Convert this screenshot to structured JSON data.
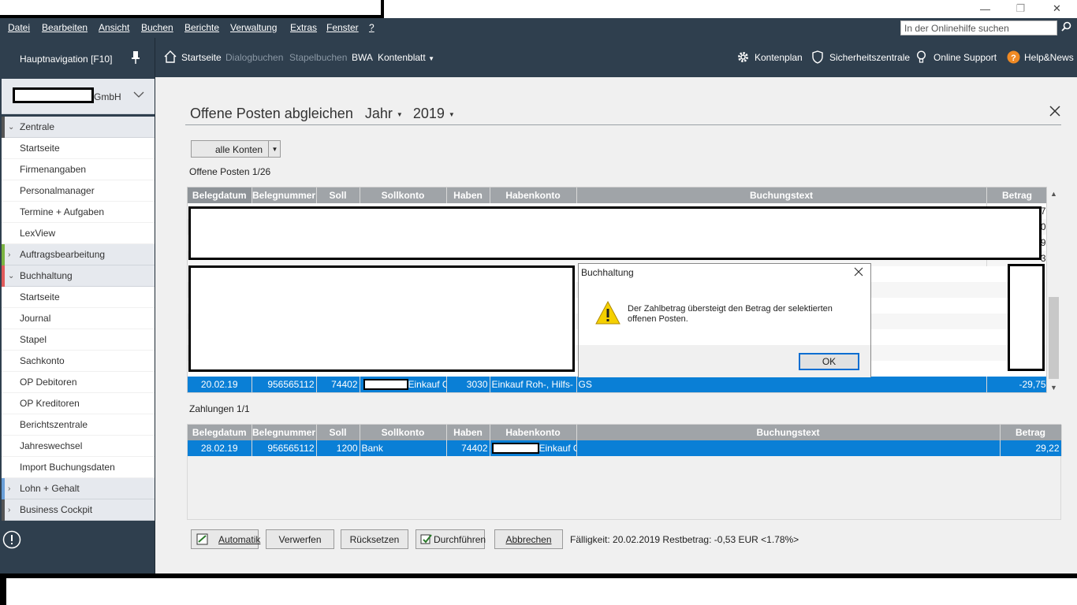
{
  "window": {
    "minimize": "—",
    "restore": "❐",
    "close": "✕"
  },
  "menu": [
    "Datei",
    "Bearbeiten",
    "Ansicht",
    "Buchen",
    "Berichte",
    "Verwaltung",
    "Extras",
    "Fenster",
    "?"
  ],
  "search": {
    "placeholder": "In der Onlinehilfe suchen"
  },
  "sidebar": {
    "header": "Hauptnavigation [F10]",
    "company_suffix": "GmbH",
    "items": [
      {
        "label": "Zentrale",
        "group": true,
        "expanded": true,
        "color": "#555555"
      },
      {
        "label": "Startseite"
      },
      {
        "label": "Firmenangaben"
      },
      {
        "label": "Personalmanager"
      },
      {
        "label": "Termine + Aufgaben"
      },
      {
        "label": "LexView"
      },
      {
        "label": "Auftragsbearbeitung",
        "group": true,
        "expanded": false,
        "color": "#7cb342"
      },
      {
        "label": "Buchhaltung",
        "group": true,
        "expanded": true,
        "color": "#e05a5a"
      },
      {
        "label": "Startseite"
      },
      {
        "label": "Journal"
      },
      {
        "label": "Stapel"
      },
      {
        "label": "Sachkonto"
      },
      {
        "label": "OP Debitoren"
      },
      {
        "label": "OP Kreditoren"
      },
      {
        "label": "Berichtszentrale"
      },
      {
        "label": "Jahreswechsel"
      },
      {
        "label": "Import Buchungsdaten"
      },
      {
        "label": "Lohn + Gehalt",
        "group": true,
        "expanded": false,
        "color": "#6a9fd8"
      },
      {
        "label": "Business Cockpit",
        "group": true,
        "expanded": false,
        "color": "#555555"
      }
    ]
  },
  "toolbar": {
    "startseite": "Startseite",
    "dialogbuchen": "Dialogbuchen",
    "stapelbuchen": "Stapelbuchen",
    "bwa": "BWA",
    "kontenblatt": "Kontenblatt",
    "kontenplan": "Kontenplan",
    "sicherheit": "Sicherheitszentrale",
    "support": "Online Support",
    "help": "Help&News"
  },
  "page": {
    "title": "Offene Posten abgleichen",
    "period_label": "Jahr",
    "year": "2019",
    "account_filter": "alle Konten",
    "op_caption": "Offene Posten 1/26",
    "pay_caption": "Zahlungen 1/1"
  },
  "op_table": {
    "headers": [
      "Belegdatum",
      "Belegnummer",
      "Soll",
      "Sollkonto",
      "Haben",
      "Habenkonto",
      "Buchungstext",
      "Betrag"
    ],
    "partial_values": [
      "7",
      "0",
      "9",
      "3"
    ],
    "selected_row": {
      "date": "20.02.19",
      "number": "956565112",
      "soll": "74402",
      "sollkonto": "Einkauf O",
      "haben": "3030",
      "habenkonto": "Einkauf Roh-, Hilfs- ur",
      "text": "GS",
      "amount": "-29,75"
    }
  },
  "pay_table": {
    "headers": [
      "Belegdatum",
      "Belegnummer",
      "Soll",
      "Sollkonto",
      "Haben",
      "Habenkonto",
      "Buchungstext",
      "Betrag"
    ],
    "row": {
      "date": "28.02.19",
      "number": "956565112",
      "soll": "1200",
      "sollkonto": "Bank",
      "haben": "74402",
      "habenkonto": "Einkauf O",
      "text": "",
      "amount": "29,22"
    }
  },
  "dialog": {
    "title": "Buchhaltung",
    "message_line1": "Der Zahlbetrag übersteigt den Betrag der selektierten",
    "message_line2": "offenen Posten.",
    "ok": "OK"
  },
  "actions": {
    "automatik": "Automatik",
    "verwerfen": "Verwerfen",
    "ruecksetzen": "Rücksetzen",
    "durchfuehren": "Durchführen",
    "abbrechen": "Abbrechen",
    "status": "Fälligkeit: 20.02.2019 Restbetrag: -0,53 EUR <1.78%>"
  }
}
